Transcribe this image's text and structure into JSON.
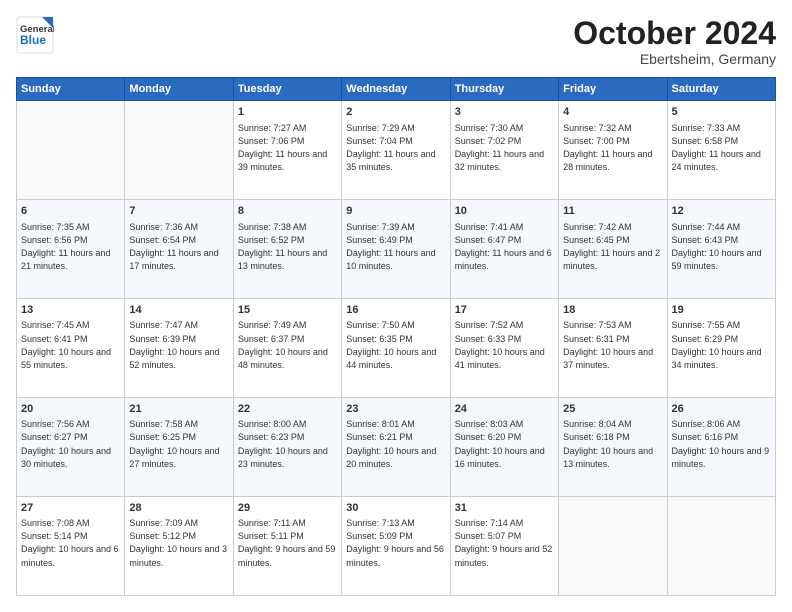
{
  "header": {
    "logo_general": "General",
    "logo_blue": "Blue",
    "month_title": "October 2024",
    "location": "Ebertsheim, Germany"
  },
  "weekdays": [
    "Sunday",
    "Monday",
    "Tuesday",
    "Wednesday",
    "Thursday",
    "Friday",
    "Saturday"
  ],
  "weeks": [
    [
      {
        "day": "",
        "info": ""
      },
      {
        "day": "",
        "info": ""
      },
      {
        "day": "1",
        "info": "Sunrise: 7:27 AM\nSunset: 7:06 PM\nDaylight: 11 hours and 39 minutes."
      },
      {
        "day": "2",
        "info": "Sunrise: 7:29 AM\nSunset: 7:04 PM\nDaylight: 11 hours and 35 minutes."
      },
      {
        "day": "3",
        "info": "Sunrise: 7:30 AM\nSunset: 7:02 PM\nDaylight: 11 hours and 32 minutes."
      },
      {
        "day": "4",
        "info": "Sunrise: 7:32 AM\nSunset: 7:00 PM\nDaylight: 11 hours and 28 minutes."
      },
      {
        "day": "5",
        "info": "Sunrise: 7:33 AM\nSunset: 6:58 PM\nDaylight: 11 hours and 24 minutes."
      }
    ],
    [
      {
        "day": "6",
        "info": "Sunrise: 7:35 AM\nSunset: 6:56 PM\nDaylight: 11 hours and 21 minutes."
      },
      {
        "day": "7",
        "info": "Sunrise: 7:36 AM\nSunset: 6:54 PM\nDaylight: 11 hours and 17 minutes."
      },
      {
        "day": "8",
        "info": "Sunrise: 7:38 AM\nSunset: 6:52 PM\nDaylight: 11 hours and 13 minutes."
      },
      {
        "day": "9",
        "info": "Sunrise: 7:39 AM\nSunset: 6:49 PM\nDaylight: 11 hours and 10 minutes."
      },
      {
        "day": "10",
        "info": "Sunrise: 7:41 AM\nSunset: 6:47 PM\nDaylight: 11 hours and 6 minutes."
      },
      {
        "day": "11",
        "info": "Sunrise: 7:42 AM\nSunset: 6:45 PM\nDaylight: 11 hours and 2 minutes."
      },
      {
        "day": "12",
        "info": "Sunrise: 7:44 AM\nSunset: 6:43 PM\nDaylight: 10 hours and 59 minutes."
      }
    ],
    [
      {
        "day": "13",
        "info": "Sunrise: 7:45 AM\nSunset: 6:41 PM\nDaylight: 10 hours and 55 minutes."
      },
      {
        "day": "14",
        "info": "Sunrise: 7:47 AM\nSunset: 6:39 PM\nDaylight: 10 hours and 52 minutes."
      },
      {
        "day": "15",
        "info": "Sunrise: 7:49 AM\nSunset: 6:37 PM\nDaylight: 10 hours and 48 minutes."
      },
      {
        "day": "16",
        "info": "Sunrise: 7:50 AM\nSunset: 6:35 PM\nDaylight: 10 hours and 44 minutes."
      },
      {
        "day": "17",
        "info": "Sunrise: 7:52 AM\nSunset: 6:33 PM\nDaylight: 10 hours and 41 minutes."
      },
      {
        "day": "18",
        "info": "Sunrise: 7:53 AM\nSunset: 6:31 PM\nDaylight: 10 hours and 37 minutes."
      },
      {
        "day": "19",
        "info": "Sunrise: 7:55 AM\nSunset: 6:29 PM\nDaylight: 10 hours and 34 minutes."
      }
    ],
    [
      {
        "day": "20",
        "info": "Sunrise: 7:56 AM\nSunset: 6:27 PM\nDaylight: 10 hours and 30 minutes."
      },
      {
        "day": "21",
        "info": "Sunrise: 7:58 AM\nSunset: 6:25 PM\nDaylight: 10 hours and 27 minutes."
      },
      {
        "day": "22",
        "info": "Sunrise: 8:00 AM\nSunset: 6:23 PM\nDaylight: 10 hours and 23 minutes."
      },
      {
        "day": "23",
        "info": "Sunrise: 8:01 AM\nSunset: 6:21 PM\nDaylight: 10 hours and 20 minutes."
      },
      {
        "day": "24",
        "info": "Sunrise: 8:03 AM\nSunset: 6:20 PM\nDaylight: 10 hours and 16 minutes."
      },
      {
        "day": "25",
        "info": "Sunrise: 8:04 AM\nSunset: 6:18 PM\nDaylight: 10 hours and 13 minutes."
      },
      {
        "day": "26",
        "info": "Sunrise: 8:06 AM\nSunset: 6:16 PM\nDaylight: 10 hours and 9 minutes."
      }
    ],
    [
      {
        "day": "27",
        "info": "Sunrise: 7:08 AM\nSunset: 5:14 PM\nDaylight: 10 hours and 6 minutes."
      },
      {
        "day": "28",
        "info": "Sunrise: 7:09 AM\nSunset: 5:12 PM\nDaylight: 10 hours and 3 minutes."
      },
      {
        "day": "29",
        "info": "Sunrise: 7:11 AM\nSunset: 5:11 PM\nDaylight: 9 hours and 59 minutes."
      },
      {
        "day": "30",
        "info": "Sunrise: 7:13 AM\nSunset: 5:09 PM\nDaylight: 9 hours and 56 minutes."
      },
      {
        "day": "31",
        "info": "Sunrise: 7:14 AM\nSunset: 5:07 PM\nDaylight: 9 hours and 52 minutes."
      },
      {
        "day": "",
        "info": ""
      },
      {
        "day": "",
        "info": ""
      }
    ]
  ]
}
